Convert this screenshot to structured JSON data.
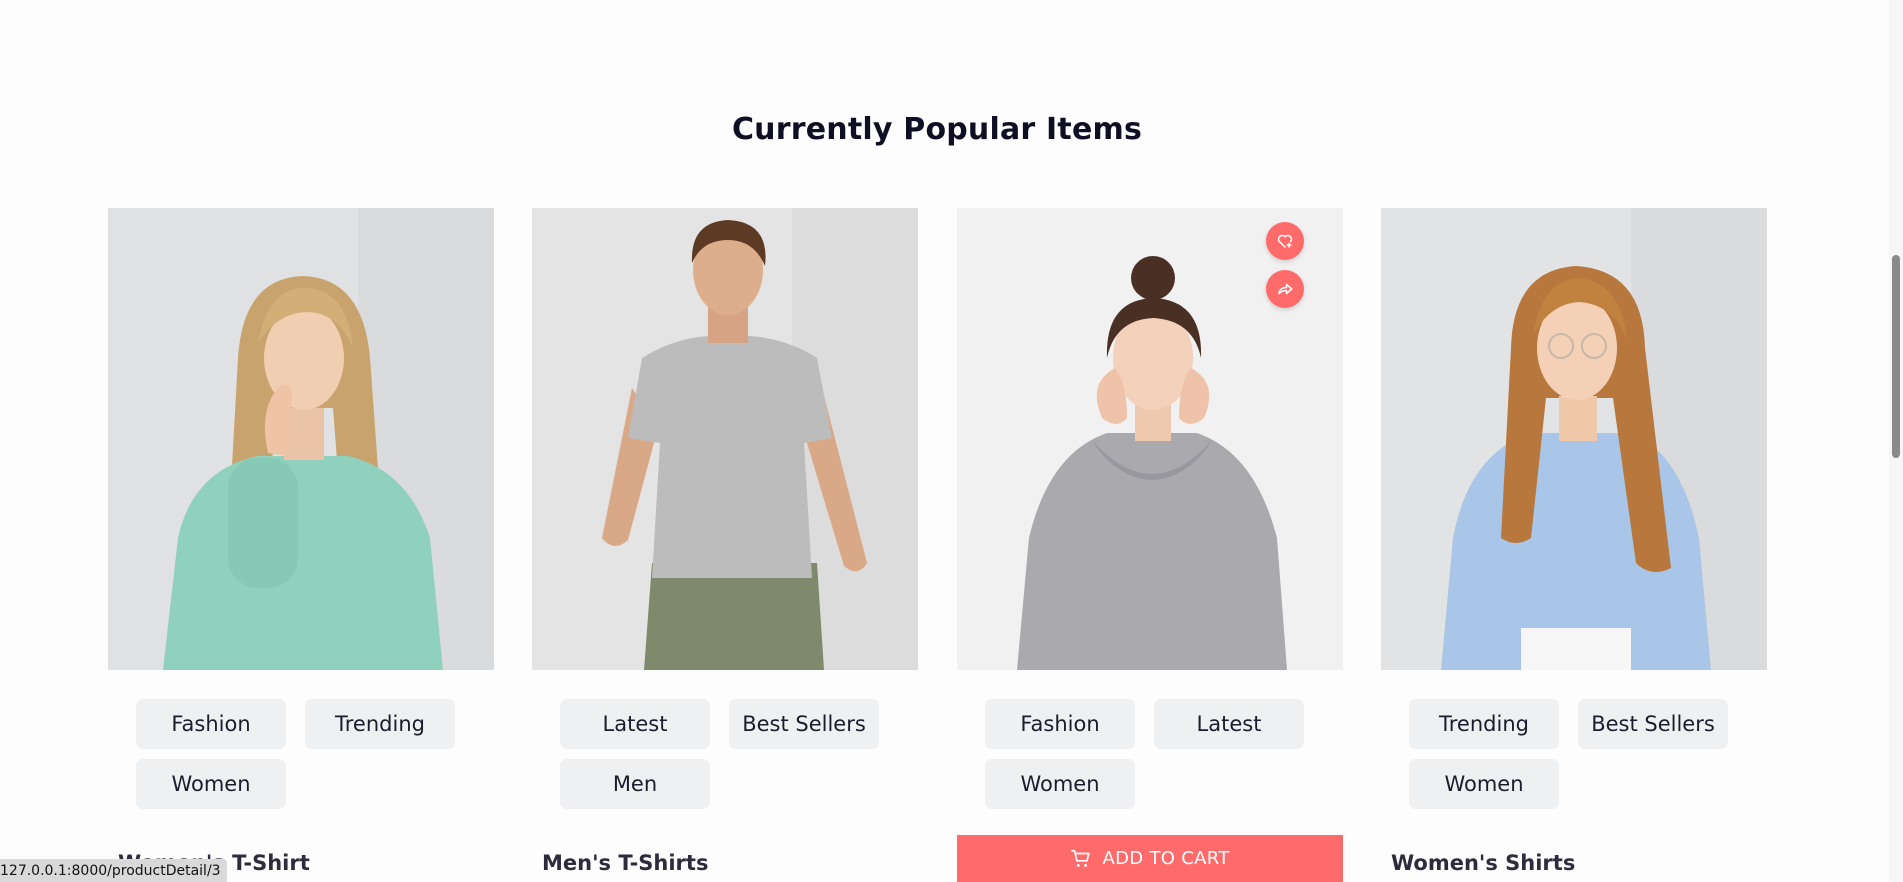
{
  "section": {
    "title": "Currently Popular Items"
  },
  "products": [
    {
      "name": "Women's T-Shirt",
      "tags": [
        "Fashion",
        "Trending",
        "Women"
      ]
    },
    {
      "name": "Men's T-Shirts",
      "tags": [
        "Latest",
        "Best Sellers",
        "Men"
      ]
    },
    {
      "name": "",
      "tags": [
        "Fashion",
        "Latest",
        "Women"
      ],
      "add_to_cart_label": "ADD TO CART"
    },
    {
      "name": "Women's Shirts",
      "tags": [
        "Trending",
        "Best Sellers",
        "Women"
      ]
    }
  ],
  "icons": {
    "wishlist": "heart-plus-icon",
    "share": "share-arrow-icon",
    "cart": "cart-icon"
  },
  "colors": {
    "accent": "#ff6b6b",
    "tag_bg": "#eff0f2",
    "title": "#0f0f23"
  },
  "status_bar": {
    "url": "127.0.0.1:8000/productDetail/3"
  }
}
